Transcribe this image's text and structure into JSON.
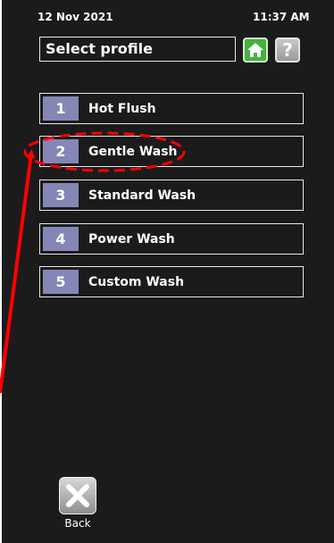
{
  "status_bar": {
    "date": "12 Nov 2021",
    "time": "11:37 AM"
  },
  "header": {
    "title": "Select profile"
  },
  "icons": {
    "home": "home-icon",
    "help": "help-icon",
    "back": "close-x-icon"
  },
  "help_glyph": "?",
  "profiles": [
    {
      "number": "1",
      "label": "Hot Flush"
    },
    {
      "number": "2",
      "label": "Gentle Wash"
    },
    {
      "number": "3",
      "label": "Standard Wash"
    },
    {
      "number": "4",
      "label": "Power Wash"
    },
    {
      "number": "5",
      "label": "Custom Wash"
    }
  ],
  "footer": {
    "back_label": "Back"
  },
  "colors": {
    "background": "#1b1b1b",
    "number_badge": "#8486b5",
    "home_button": "#45b23f",
    "annotation": "#ff0000"
  }
}
